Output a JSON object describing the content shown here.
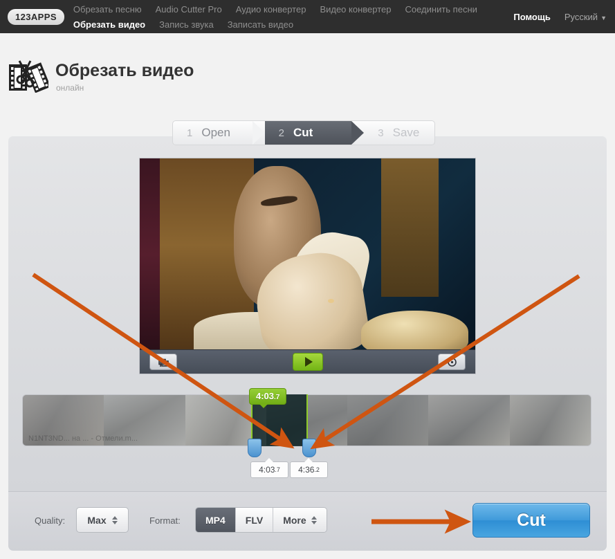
{
  "nav": {
    "logo": "123APPS",
    "row1": [
      {
        "label": "Обрезать песню",
        "active": false
      },
      {
        "label": "Audio Cutter Pro",
        "active": false
      },
      {
        "label": "Аудио конвертер",
        "active": false
      },
      {
        "label": "Видео конвертер",
        "active": false
      },
      {
        "label": "Соединить песни",
        "active": false
      }
    ],
    "row2": [
      {
        "label": "Обрезать видео",
        "active": true
      },
      {
        "label": "Запись звука",
        "active": false
      },
      {
        "label": "Записать видео",
        "active": false
      }
    ],
    "help": "Помощь",
    "language": "Русский",
    "language_caret": "▼"
  },
  "header": {
    "title": "Обрезать видео",
    "subtitle": "онлайн",
    "icon": "film-scissors-icon"
  },
  "wizard": {
    "steps": [
      {
        "num": "1",
        "label": "Open",
        "state": "done"
      },
      {
        "num": "2",
        "label": "Cut",
        "state": "active"
      },
      {
        "num": "3",
        "label": "Save",
        "state": "upcoming"
      }
    ]
  },
  "player": {
    "left_button_icon": "crop-frame-icon",
    "play_button_icon": "play-icon",
    "right_button_icon": "settings-circle-icon"
  },
  "timeline": {
    "tooltip": {
      "time": "4:03",
      "fraction": ".7"
    },
    "start_field": {
      "time": "4:03",
      "fraction": ".7"
    },
    "end_field": {
      "time": "4:36",
      "fraction": ".2"
    },
    "watermark": "N1NT3ND... на ... - Отмели.m...",
    "handle_left_icon": "range-handle-left",
    "handle_right_icon": "range-handle-right"
  },
  "controls": {
    "quality_label": "Quality:",
    "quality_value": "Max",
    "format_label": "Format:",
    "formats": [
      {
        "label": "MP4",
        "selected": true,
        "stepper": false
      },
      {
        "label": "FLV",
        "selected": false,
        "stepper": false
      },
      {
        "label": "More",
        "selected": false,
        "stepper": true
      }
    ],
    "cut_button": "Cut"
  },
  "colors": {
    "nav_bg": "#2e2e2e",
    "accent_blue": "#3f9ada",
    "accent_green": "#7cb820",
    "annotation_orange": "#cf5511",
    "handle_blue": "#4b92cf",
    "step_active": "#52565e"
  }
}
